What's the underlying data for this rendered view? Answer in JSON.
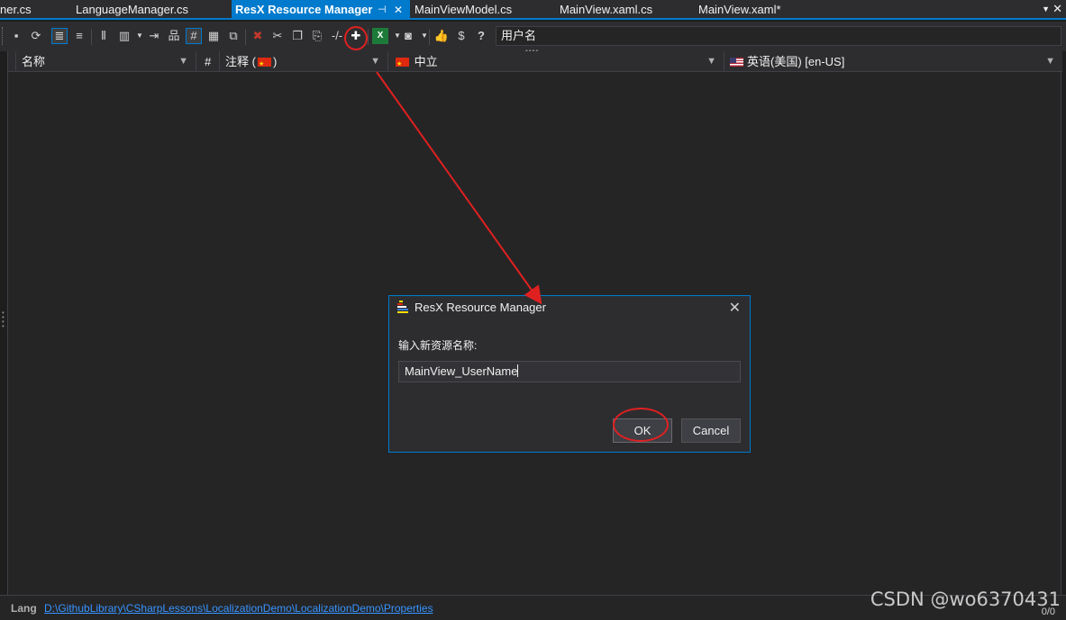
{
  "tabs": [
    {
      "label": "ner.cs"
    },
    {
      "label": "LanguageManager.cs"
    },
    {
      "label": "ResX Resource Manager",
      "active": true,
      "pin_icon": "pin-icon",
      "close_icon": "close-icon"
    },
    {
      "label": "MainViewModel.cs"
    },
    {
      "label": "MainView.xaml.cs"
    },
    {
      "label": "MainView.xaml*"
    }
  ],
  "toolbar": {
    "icons": [
      "save-icon",
      "refresh-icon",
      "list-view-icon",
      "align-icon",
      "columns-icon",
      "columns-dropdown-icon",
      "export-icon",
      "hierarchy-icon",
      "hash-icon",
      "grid-icon",
      "snippet-icon",
      "delete-icon",
      "cut-icon",
      "copy-icon",
      "paste-icon",
      "invariant-icon",
      "add-icon",
      "excel-icon",
      "screenshot-icon",
      "like-icon",
      "donate-icon",
      "help-icon"
    ],
    "search_value": "用户名"
  },
  "grid": {
    "columns": [
      {
        "label": "名称"
      },
      {
        "label": "#"
      },
      {
        "label_prefix": "注释 (",
        "label_suffix": ")",
        "flag": "cn"
      },
      {
        "label": "中立",
        "flag": "cn"
      },
      {
        "label": "英语(美国) [en-US]",
        "flag": "us"
      }
    ]
  },
  "status": {
    "lang_label": "Lang",
    "path": "D:\\GithubLibrary\\CSharpLessons\\LocalizationDemo\\LocalizationDemo\\Properties",
    "count": "0/0"
  },
  "dialog": {
    "title": "ResX Resource Manager",
    "prompt": "输入新资源名称:",
    "input_value": "MainView_UserName",
    "ok_label": "OK",
    "cancel_label": "Cancel"
  },
  "watermark": "CSDN @wo6370431",
  "colors": {
    "accent": "#007acc",
    "annotation_red": "#e02020",
    "link": "#3794ff"
  }
}
